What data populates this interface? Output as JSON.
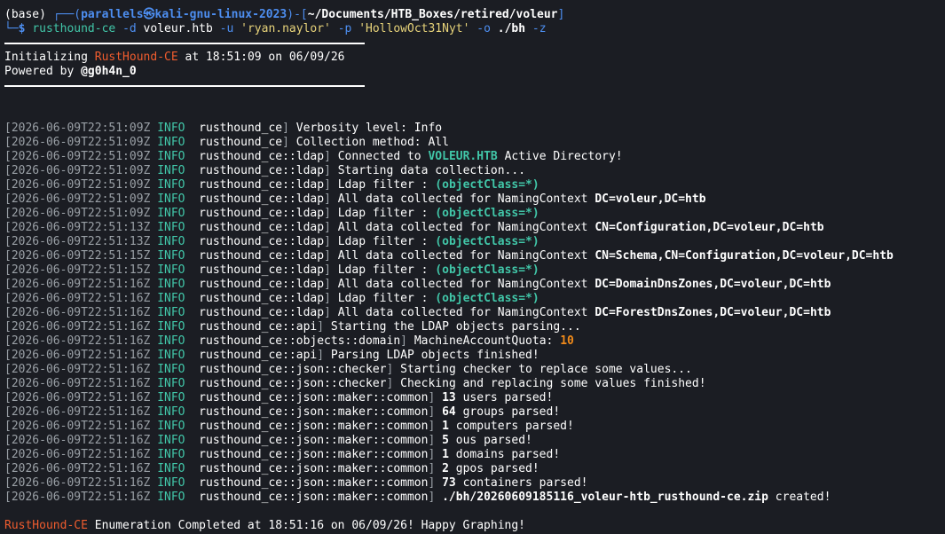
{
  "prompt": {
    "env": "(base)",
    "box_left": "┌──(",
    "user_host": "parallels㉿kali-gnu-linux-2023",
    "mid": ")-[",
    "path": "~/Documents/HTB_Boxes/retired/voleur",
    "end": "]",
    "line2_prefix": "└─",
    "dollar": "$",
    "cmd": "rusthound-ce",
    "arg_d": "-d",
    "domain": "voleur.htb",
    "arg_u": "-u",
    "username": "'ryan.naylor'",
    "arg_p": "-p",
    "password": "'HollowOct31Nyt'",
    "arg_o": "-o",
    "outdir": "./bh",
    "arg_z": "-z"
  },
  "banner": {
    "init_prefix": "Initializing ",
    "tool": "RustHound-CE",
    "init_suffix": " at 18:51:09 on 06/09/26",
    "powered_prefix": "Powered by ",
    "author": "@g0h4n_0"
  },
  "logs": [
    {
      "ts": "2026-06-09T22:51:09Z",
      "lvl": "INFO",
      "mod": "rusthound_ce",
      "msg": "Verbosity level: Info",
      "hl": "",
      "tail": "",
      "hl_class": ""
    },
    {
      "ts": "2026-06-09T22:51:09Z",
      "lvl": "INFO",
      "mod": "rusthound_ce",
      "msg": "Collection method: All",
      "hl": "",
      "tail": "",
      "hl_class": ""
    },
    {
      "ts": "2026-06-09T22:51:09Z",
      "lvl": "INFO",
      "mod": "rusthound_ce::ldap",
      "msg": "Connected to ",
      "hl": "VOLEUR.HTB",
      "tail": " Active Directory!",
      "hl_class": "teal-b"
    },
    {
      "ts": "2026-06-09T22:51:09Z",
      "lvl": "INFO",
      "mod": "rusthound_ce::ldap",
      "msg": "Starting data collection...",
      "hl": "",
      "tail": "",
      "hl_class": ""
    },
    {
      "ts": "2026-06-09T22:51:09Z",
      "lvl": "INFO",
      "mod": "rusthound_ce::ldap",
      "msg": "Ldap filter : ",
      "hl": "(objectClass=*)",
      "tail": "",
      "hl_class": "teal-b"
    },
    {
      "ts": "2026-06-09T22:51:09Z",
      "lvl": "INFO",
      "mod": "rusthound_ce::ldap",
      "msg": "All data collected for NamingContext ",
      "hl": "DC=voleur,DC=htb",
      "tail": "",
      "hl_class": "white-b"
    },
    {
      "ts": "2026-06-09T22:51:09Z",
      "lvl": "INFO",
      "mod": "rusthound_ce::ldap",
      "msg": "Ldap filter : ",
      "hl": "(objectClass=*)",
      "tail": "",
      "hl_class": "teal-b"
    },
    {
      "ts": "2026-06-09T22:51:13Z",
      "lvl": "INFO",
      "mod": "rusthound_ce::ldap",
      "msg": "All data collected for NamingContext ",
      "hl": "CN=Configuration,DC=voleur,DC=htb",
      "tail": "",
      "hl_class": "white-b"
    },
    {
      "ts": "2026-06-09T22:51:13Z",
      "lvl": "INFO",
      "mod": "rusthound_ce::ldap",
      "msg": "Ldap filter : ",
      "hl": "(objectClass=*)",
      "tail": "",
      "hl_class": "teal-b"
    },
    {
      "ts": "2026-06-09T22:51:15Z",
      "lvl": "INFO",
      "mod": "rusthound_ce::ldap",
      "msg": "All data collected for NamingContext ",
      "hl": "CN=Schema,CN=Configuration,DC=voleur,DC=htb",
      "tail": "",
      "hl_class": "white-b"
    },
    {
      "ts": "2026-06-09T22:51:15Z",
      "lvl": "INFO",
      "mod": "rusthound_ce::ldap",
      "msg": "Ldap filter : ",
      "hl": "(objectClass=*)",
      "tail": "",
      "hl_class": "teal-b"
    },
    {
      "ts": "2026-06-09T22:51:16Z",
      "lvl": "INFO",
      "mod": "rusthound_ce::ldap",
      "msg": "All data collected for NamingContext ",
      "hl": "DC=DomainDnsZones,DC=voleur,DC=htb",
      "tail": "",
      "hl_class": "white-b"
    },
    {
      "ts": "2026-06-09T22:51:16Z",
      "lvl": "INFO",
      "mod": "rusthound_ce::ldap",
      "msg": "Ldap filter : ",
      "hl": "(objectClass=*)",
      "tail": "",
      "hl_class": "teal-b"
    },
    {
      "ts": "2026-06-09T22:51:16Z",
      "lvl": "INFO",
      "mod": "rusthound_ce::ldap",
      "msg": "All data collected for NamingContext ",
      "hl": "DC=ForestDnsZones,DC=voleur,DC=htb",
      "tail": "",
      "hl_class": "white-b"
    },
    {
      "ts": "2026-06-09T22:51:16Z",
      "lvl": "INFO",
      "mod": "rusthound_ce::api",
      "msg": "Starting the LDAP objects parsing...",
      "hl": "",
      "tail": "",
      "hl_class": ""
    },
    {
      "ts": "2026-06-09T22:51:16Z",
      "lvl": "INFO",
      "mod": "rusthound_ce::objects::domain",
      "msg": "MachineAccountQuota: ",
      "hl": "10",
      "tail": "",
      "hl_class": "num-orange"
    },
    {
      "ts": "2026-06-09T22:51:16Z",
      "lvl": "INFO",
      "mod": "rusthound_ce::api",
      "msg": "Parsing LDAP objects finished!",
      "hl": "",
      "tail": "",
      "hl_class": ""
    },
    {
      "ts": "2026-06-09T22:51:16Z",
      "lvl": "INFO",
      "mod": "rusthound_ce::json::checker",
      "msg": "Starting checker to replace some values...",
      "hl": "",
      "tail": "",
      "hl_class": ""
    },
    {
      "ts": "2026-06-09T22:51:16Z",
      "lvl": "INFO",
      "mod": "rusthound_ce::json::checker",
      "msg": "Checking and replacing some values finished!",
      "hl": "",
      "tail": "",
      "hl_class": ""
    },
    {
      "ts": "2026-06-09T22:51:16Z",
      "lvl": "INFO",
      "mod": "rusthound_ce::json::maker::common",
      "msg": "",
      "hl": "13",
      "tail": " users parsed!",
      "hl_class": "white-b"
    },
    {
      "ts": "2026-06-09T22:51:16Z",
      "lvl": "INFO",
      "mod": "rusthound_ce::json::maker::common",
      "msg": "",
      "hl": "64",
      "tail": " groups parsed!",
      "hl_class": "white-b"
    },
    {
      "ts": "2026-06-09T22:51:16Z",
      "lvl": "INFO",
      "mod": "rusthound_ce::json::maker::common",
      "msg": "",
      "hl": "1",
      "tail": " computers parsed!",
      "hl_class": "white-b"
    },
    {
      "ts": "2026-06-09T22:51:16Z",
      "lvl": "INFO",
      "mod": "rusthound_ce::json::maker::common",
      "msg": "",
      "hl": "5",
      "tail": " ous parsed!",
      "hl_class": "white-b"
    },
    {
      "ts": "2026-06-09T22:51:16Z",
      "lvl": "INFO",
      "mod": "rusthound_ce::json::maker::common",
      "msg": "",
      "hl": "1",
      "tail": " domains parsed!",
      "hl_class": "white-b"
    },
    {
      "ts": "2026-06-09T22:51:16Z",
      "lvl": "INFO",
      "mod": "rusthound_ce::json::maker::common",
      "msg": "",
      "hl": "2",
      "tail": " gpos parsed!",
      "hl_class": "white-b"
    },
    {
      "ts": "2026-06-09T22:51:16Z",
      "lvl": "INFO",
      "mod": "rusthound_ce::json::maker::common",
      "msg": "",
      "hl": "73",
      "tail": " containers parsed!",
      "hl_class": "white-b"
    },
    {
      "ts": "2026-06-09T22:51:16Z",
      "lvl": "INFO",
      "mod": "rusthound_ce::json::maker::common",
      "msg": "",
      "hl": "./bh/20260609185116_voleur-htb_rusthound-ce.zip",
      "tail": " created!",
      "hl_class": "white-b"
    }
  ],
  "footer": {
    "tool": "RustHound-CE",
    "text": " Enumeration Completed at 18:51:16 on 06/09/26! Happy Graphing!"
  },
  "colors": {
    "background": "#1b1d23",
    "prompt_blue": "#4d8ef0",
    "teal": "#41c6a8",
    "orange": "#f05c2e",
    "gray": "#9aa0a6"
  }
}
